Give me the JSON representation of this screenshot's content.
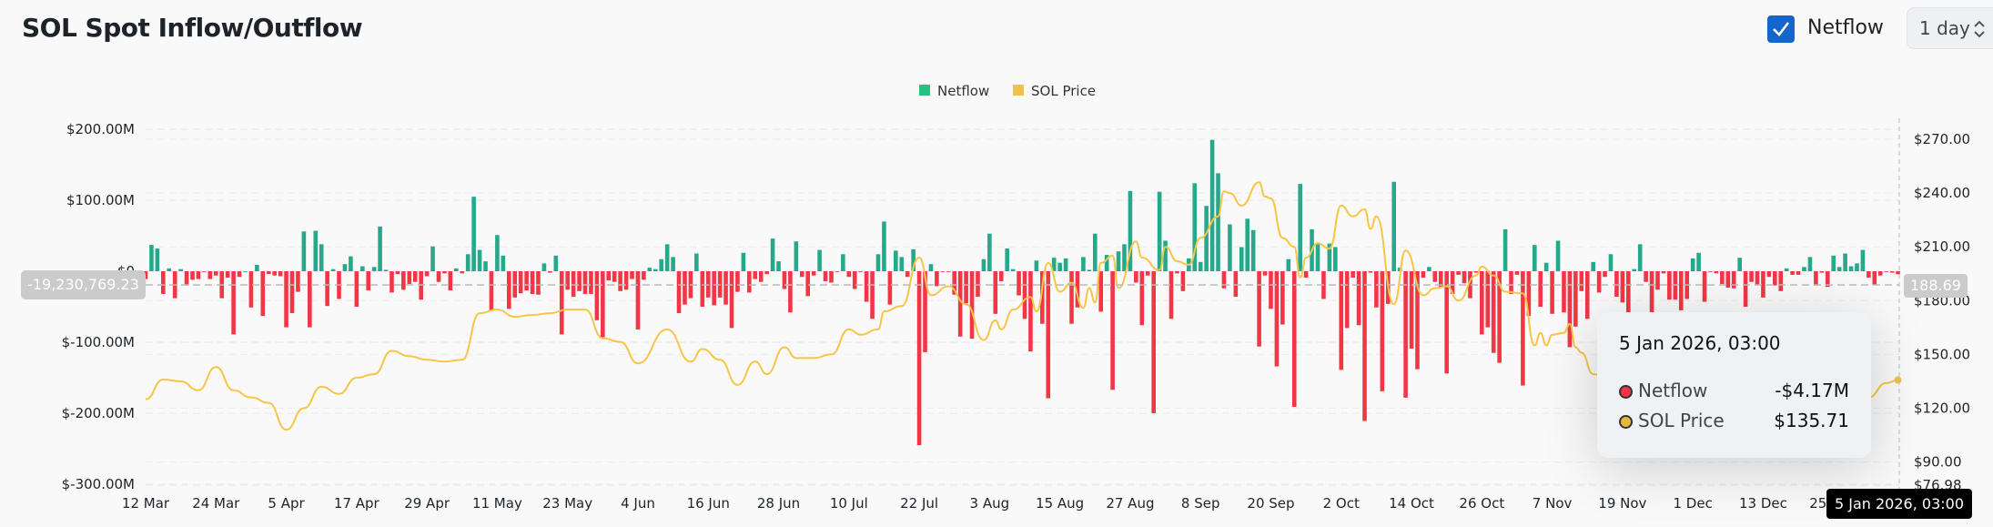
{
  "header": {
    "title": "SOL Spot Inflow/Outflow",
    "netflow_toggle_label": "Netflow",
    "netflow_checked": true,
    "interval": "1 day"
  },
  "colors": {
    "inflow": "#26a98b",
    "outflow": "#f23645",
    "price": "#f7c548",
    "checkbox": "#1466cc"
  },
  "tooltip": {
    "date": "5 Jan 2026, 03:00",
    "rows": [
      {
        "label": "Netflow",
        "value": "-$4.17M",
        "color": "#f23645"
      },
      {
        "label": "SOL Price",
        "value": "$135.71",
        "color": "#e8b53e"
      }
    ]
  },
  "crosshair": {
    "left_value": "-19,230,769.23",
    "right_value": "188.69",
    "x_label": "5 Jan 2026, 03:00"
  },
  "chart_data": {
    "type": "bar+line",
    "title": "SOL Spot Inflow/Outflow",
    "legend": [
      "Netflow",
      "SOL Price"
    ],
    "legend_position": "top-center",
    "start_date": "12 Mar 2025",
    "x_tick_labels": [
      "12 Mar",
      "24 Mar",
      "5 Apr",
      "17 Apr",
      "29 Apr",
      "11 May",
      "23 May",
      "4 Jun",
      "16 Jun",
      "28 Jun",
      "10 Jul",
      "22 Jul",
      "3 Aug",
      "15 Aug",
      "27 Aug",
      "8 Sep",
      "20 Sep",
      "2 Oct",
      "14 Oct",
      "26 Oct",
      "7 Nov",
      "19 Nov",
      "1 Dec",
      "13 Dec",
      "25 Dec"
    ],
    "x_tick_step_days": 12,
    "y_left": {
      "ticks": [
        200,
        100,
        0,
        -100,
        -200,
        -300
      ],
      "labels": [
        "$200.00M",
        "$100.00M",
        "$0",
        "$-100.00M",
        "$-200.00M",
        "$-300.00M"
      ],
      "range": [
        -300,
        200
      ],
      "unit": "USD millions"
    },
    "y_right": {
      "ticks": [
        270,
        240,
        210,
        180,
        150,
        120,
        90,
        76.98
      ],
      "labels": [
        "$270.00",
        "$240.00",
        "$210.00",
        "$180.00",
        "$150.00",
        "$120.00",
        "$90.00",
        "$76.98"
      ],
      "range": [
        76.98,
        270
      ]
    },
    "netflow_m": [
      -11,
      37,
      32,
      -32,
      4,
      -38,
      3,
      -20,
      -12,
      -11,
      -1,
      -11,
      -6,
      -38,
      -9,
      -89,
      -8,
      0,
      -51,
      9,
      -63,
      -4,
      -6,
      -7,
      -79,
      -59,
      -29,
      56,
      -79,
      57,
      38,
      -49,
      3,
      -39,
      10,
      21,
      -50,
      7,
      -27,
      6,
      63,
      2,
      -30,
      -4,
      -26,
      -18,
      -15,
      -40,
      -7,
      35,
      -15,
      -3,
      -27,
      4,
      -3,
      24,
      105,
      30,
      14,
      -56,
      51,
      22,
      -53,
      -37,
      -31,
      -27,
      -32,
      -33,
      11,
      -2,
      22,
      -89,
      -26,
      -36,
      -28,
      -32,
      -32,
      -69,
      -93,
      -13,
      -15,
      -28,
      -26,
      -11,
      -82,
      -12,
      5,
      3,
      17,
      38,
      20,
      -59,
      -47,
      -38,
      25,
      -50,
      -37,
      -48,
      -37,
      -47,
      -80,
      -29,
      26,
      -30,
      -11,
      -15,
      -4,
      46,
      14,
      -25,
      -58,
      42,
      -8,
      -35,
      -6,
      30,
      -14,
      -16,
      -1,
      24,
      -8,
      -25,
      -1,
      -43,
      -67,
      24,
      70,
      -47,
      29,
      20,
      -8,
      31,
      -245,
      -114,
      10,
      -21,
      -1,
      -1,
      -33,
      -92,
      -45,
      -95,
      -36,
      17,
      53,
      -60,
      -14,
      32,
      3,
      -34,
      -67,
      -113,
      15,
      -74,
      -179,
      19,
      12,
      18,
      -74,
      -51,
      20,
      2,
      53,
      -57,
      23,
      -167,
      28,
      38,
      113,
      -16,
      -76,
      -6,
      -200,
      112,
      43,
      -67,
      -3,
      -28,
      18,
      124,
      13,
      92,
      185,
      138,
      -24,
      66,
      -36,
      34,
      74,
      58,
      -106,
      -6,
      -53,
      -134,
      -75,
      17,
      -191,
      123,
      -9,
      59,
      38,
      -39,
      39,
      34,
      -139,
      -80,
      -9,
      -76,
      -211,
      -2,
      -51,
      -169,
      -46,
      126,
      5,
      -178,
      -109,
      -138,
      -9,
      6,
      -15,
      -22,
      -144,
      -32,
      -5,
      -17,
      -38,
      -2,
      -89,
      -79,
      -115,
      -129,
      59,
      -32,
      -5,
      -161,
      -63,
      37,
      -50,
      12,
      -60,
      43,
      -58,
      -107,
      -78,
      -28,
      -67,
      13,
      -30,
      -8,
      24,
      -36,
      -44,
      -58,
      3,
      38,
      -15,
      -58,
      -26,
      -3,
      -40,
      -40,
      -55,
      -39,
      18,
      26,
      -43,
      -1,
      -3,
      -18,
      -23,
      -24,
      19,
      -50,
      -15,
      -19,
      -37,
      -8,
      -20,
      -28,
      4,
      -5,
      -5,
      6,
      20,
      -20,
      -2,
      -22,
      22,
      6,
      25,
      7,
      11,
      30,
      -9,
      -19,
      -6,
      -1,
      -2,
      -4.17
    ],
    "sol_price_points": [
      [
        0,
        125
      ],
      [
        3,
        136
      ],
      [
        6,
        135
      ],
      [
        9,
        130
      ],
      [
        12,
        143
      ],
      [
        15,
        130
      ],
      [
        18,
        126
      ],
      [
        21,
        123
      ],
      [
        24,
        108
      ],
      [
        27,
        120
      ],
      [
        30,
        132
      ],
      [
        33,
        128
      ],
      [
        36,
        137
      ],
      [
        39,
        139
      ],
      [
        42,
        152
      ],
      [
        45,
        149
      ],
      [
        48,
        147
      ],
      [
        51,
        146
      ],
      [
        54,
        147
      ],
      [
        57,
        173
      ],
      [
        60,
        175
      ],
      [
        63,
        171
      ],
      [
        66,
        172
      ],
      [
        69,
        173
      ],
      [
        72,
        175
      ],
      [
        75,
        175
      ],
      [
        78,
        159
      ],
      [
        81,
        157
      ],
      [
        84,
        145
      ],
      [
        89,
        164
      ],
      [
        93,
        146
      ],
      [
        95,
        153
      ],
      [
        98,
        147
      ],
      [
        101,
        133
      ],
      [
        104,
        146
      ],
      [
        106,
        139
      ],
      [
        109,
        154
      ],
      [
        111,
        148
      ],
      [
        114,
        148
      ],
      [
        117,
        150
      ],
      [
        120,
        164
      ],
      [
        122,
        161
      ],
      [
        125,
        164
      ],
      [
        126,
        174
      ],
      [
        129,
        177
      ],
      [
        132,
        204
      ],
      [
        134,
        183
      ],
      [
        137,
        188
      ],
      [
        140,
        178
      ],
      [
        143,
        158
      ],
      [
        145,
        169
      ],
      [
        146,
        164
      ],
      [
        148,
        175
      ],
      [
        151,
        182
      ],
      [
        152,
        174
      ],
      [
        154,
        201
      ],
      [
        156,
        185
      ],
      [
        158,
        190
      ],
      [
        160,
        176
      ],
      [
        161,
        187
      ],
      [
        162,
        179
      ],
      [
        163,
        201
      ],
      [
        165,
        205
      ],
      [
        166,
        187
      ],
      [
        169,
        213
      ],
      [
        170,
        204
      ],
      [
        173,
        197
      ],
      [
        174,
        210
      ],
      [
        176,
        202
      ],
      [
        178,
        200
      ],
      [
        180,
        215
      ],
      [
        183,
        227
      ],
      [
        184,
        241
      ],
      [
        185,
        240
      ],
      [
        187,
        233
      ],
      [
        190,
        246
      ],
      [
        191,
        238
      ],
      [
        192,
        237
      ],
      [
        194,
        215
      ],
      [
        196,
        210
      ],
      [
        197,
        193
      ],
      [
        198,
        204
      ],
      [
        200,
        212
      ],
      [
        202,
        209
      ],
      [
        204,
        233
      ],
      [
        206,
        227
      ],
      [
        208,
        231
      ],
      [
        209,
        220
      ],
      [
        210,
        227
      ],
      [
        213,
        178
      ],
      [
        215,
        208
      ],
      [
        218,
        183
      ],
      [
        220,
        187
      ],
      [
        222,
        188
      ],
      [
        224,
        180
      ],
      [
        227,
        194
      ],
      [
        228,
        199
      ],
      [
        230,
        194
      ],
      [
        232,
        185
      ],
      [
        235,
        184
      ],
      [
        237,
        155
      ],
      [
        238,
        162
      ],
      [
        239,
        155
      ],
      [
        240,
        161
      ],
      [
        242,
        162
      ],
      [
        243,
        167
      ],
      [
        244,
        154
      ],
      [
        245,
        151
      ],
      [
        247,
        139
      ],
      [
        250,
        137
      ],
      [
        255,
        140
      ],
      [
        260,
        133
      ],
      [
        265,
        129
      ],
      [
        270,
        132
      ],
      [
        275,
        130
      ],
      [
        280,
        127
      ],
      [
        285,
        124
      ],
      [
        290,
        125
      ],
      [
        294,
        126
      ],
      [
        297,
        134
      ],
      [
        299,
        135.71
      ]
    ],
    "grid": true
  }
}
